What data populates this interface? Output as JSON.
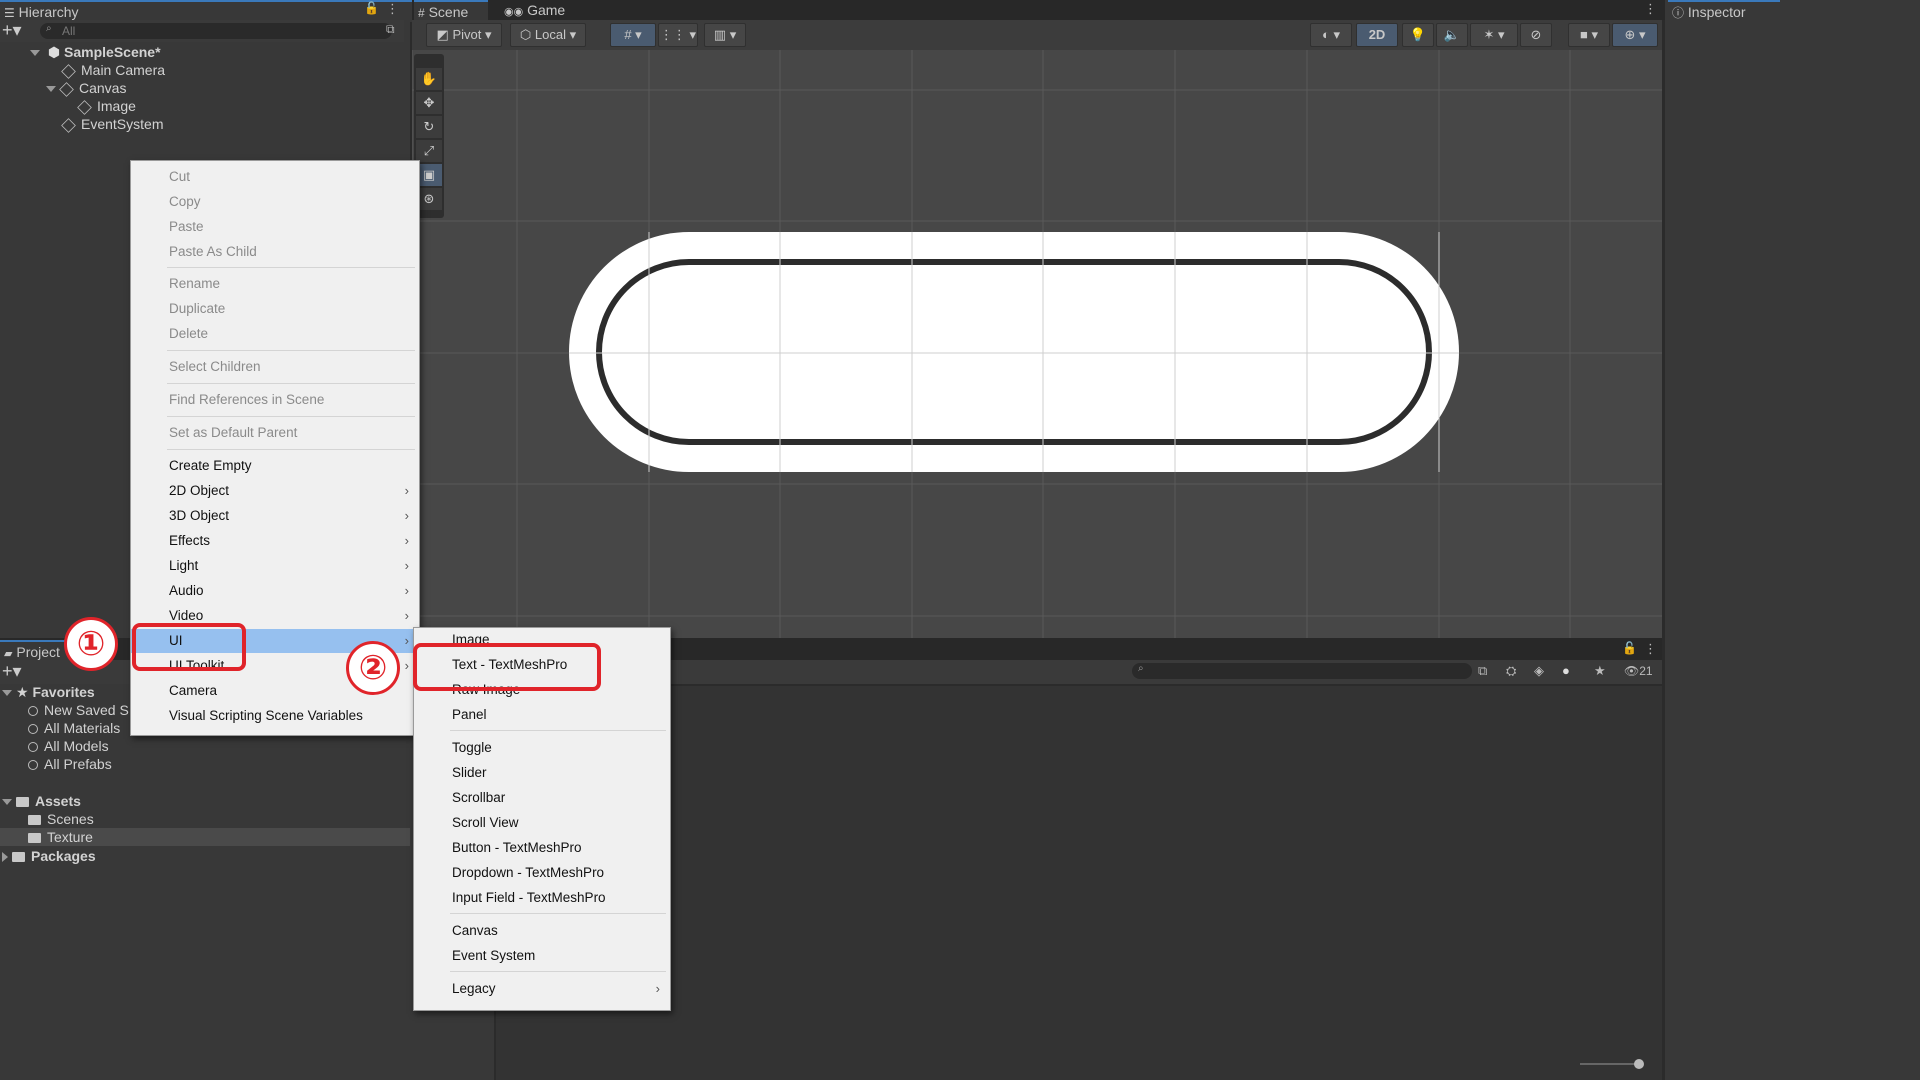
{
  "hierarchy": {
    "tab_label": "Hierarchy",
    "search_placeholder": "All",
    "items": [
      {
        "label": "SampleScene*"
      },
      {
        "label": "Main Camera"
      },
      {
        "label": "Canvas"
      },
      {
        "label": "Image"
      },
      {
        "label": "EventSystem"
      }
    ]
  },
  "scene": {
    "tabs": [
      {
        "label": "Scene"
      },
      {
        "label": "Game"
      }
    ],
    "toolbar": {
      "pivot": "Pivot",
      "local": "Local",
      "mode_2d": "2D"
    },
    "tools": [
      "hand-icon",
      "move-icon",
      "rotate-icon",
      "scale-icon",
      "rect-icon",
      "transform-icon"
    ]
  },
  "inspector": {
    "tab_label": "Inspector"
  },
  "project": {
    "tab_label": "Project",
    "visible_count": "21",
    "favorites_label": "Favorites",
    "favorites": [
      {
        "label": "New Saved S"
      },
      {
        "label": "All Materials"
      },
      {
        "label": "All Models"
      },
      {
        "label": "All Prefabs"
      }
    ],
    "assets_label": "Assets",
    "assets": [
      {
        "label": "Scenes"
      },
      {
        "label": "Texture"
      }
    ],
    "packages_label": "Packages"
  },
  "context_menu": {
    "items": [
      {
        "label": "Cut"
      },
      {
        "label": "Copy"
      },
      {
        "label": "Paste"
      },
      {
        "label": "Paste As Child"
      },
      {
        "label": "Rename"
      },
      {
        "label": "Duplicate"
      },
      {
        "label": "Delete"
      },
      {
        "label": "Select Children"
      },
      {
        "label": "Find References in Scene"
      },
      {
        "label": "Set as Default Parent"
      },
      {
        "label": "Create Empty"
      },
      {
        "label": "2D Object"
      },
      {
        "label": "3D Object"
      },
      {
        "label": "Effects"
      },
      {
        "label": "Light"
      },
      {
        "label": "Audio"
      },
      {
        "label": "Video"
      },
      {
        "label": "UI"
      },
      {
        "label": "UI Toolkit"
      },
      {
        "label": "Camera"
      },
      {
        "label": "Visual Scripting Scene Variables"
      }
    ]
  },
  "ui_submenu": {
    "items": [
      {
        "label": "Image"
      },
      {
        "label": "Text - TextMeshPro"
      },
      {
        "label": "Raw Image"
      },
      {
        "label": "Panel"
      },
      {
        "label": "Toggle"
      },
      {
        "label": "Slider"
      },
      {
        "label": "Scrollbar"
      },
      {
        "label": "Scroll View"
      },
      {
        "label": "Button - TextMeshPro"
      },
      {
        "label": "Dropdown - TextMeshPro"
      },
      {
        "label": "Input Field - TextMeshPro"
      },
      {
        "label": "Canvas"
      },
      {
        "label": "Event System"
      },
      {
        "label": "Legacy"
      }
    ]
  },
  "annotations": {
    "step1": "①",
    "step2": "②"
  },
  "colors": {
    "accent_red": "#e0242a",
    "highlight": "#96c0ef",
    "selection_blue": "#3a79bb"
  }
}
